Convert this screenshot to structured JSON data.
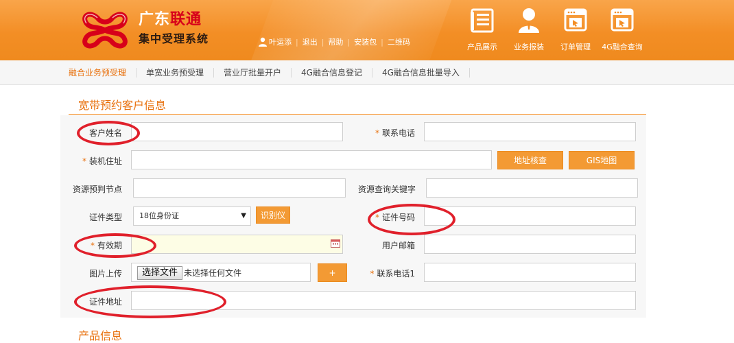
{
  "brand": {
    "line1_a": "广东",
    "line1_b": "联通",
    "line2": "集中受理系统"
  },
  "user": {
    "name": "叶运添",
    "links": [
      "退出",
      "帮助",
      "安装包",
      "二维码"
    ]
  },
  "topnav": [
    {
      "label": "产品展示",
      "icon": "newspaper-icon"
    },
    {
      "label": "业务报装",
      "icon": "user-icon"
    },
    {
      "label": "订单管理",
      "icon": "cursor-window-icon"
    },
    {
      "label": "4G融合查询",
      "icon": "cursor-window-icon"
    }
  ],
  "subnav": [
    "融合业务预受理",
    "单宽业务预受理",
    "营业厅批量开户",
    "4G融合信息登记",
    "4G融合信息批量导入"
  ],
  "section1_title": "宽带预约客户信息",
  "section2_title": "产品信息",
  "form": {
    "customer_name": {
      "label": "客户姓名",
      "value": ""
    },
    "phone": {
      "label": "联系电话",
      "value": "",
      "required": true
    },
    "install_address": {
      "label": "装机住址",
      "value": "",
      "required": true
    },
    "address_check_btn": "地址核查",
    "gis_map_btn": "GIS地图",
    "resource_node": {
      "label": "资源预判节点",
      "value": ""
    },
    "resource_keyword": {
      "label": "资源查询关键字",
      "value": ""
    },
    "id_type": {
      "label": "证件类型",
      "selected": "18位身份证"
    },
    "id_reader_btn": "识别仪",
    "id_number": {
      "label": "证件号码",
      "value": "",
      "required": true
    },
    "validity": {
      "label": "有效期",
      "value": "",
      "required": true
    },
    "email": {
      "label": "用户邮箱",
      "value": ""
    },
    "image_upload": {
      "label": "图片上传",
      "choose_btn": "选择文件",
      "status": "未选择任何文件",
      "add_btn": "+"
    },
    "phone1": {
      "label": "联系电话1",
      "value": "",
      "required": true
    },
    "id_address": {
      "label": "证件地址",
      "value": ""
    }
  },
  "colors": {
    "brand_orange": "#f38e25",
    "accent_text": "#e8700c",
    "annotation_red": "#e0202b"
  }
}
